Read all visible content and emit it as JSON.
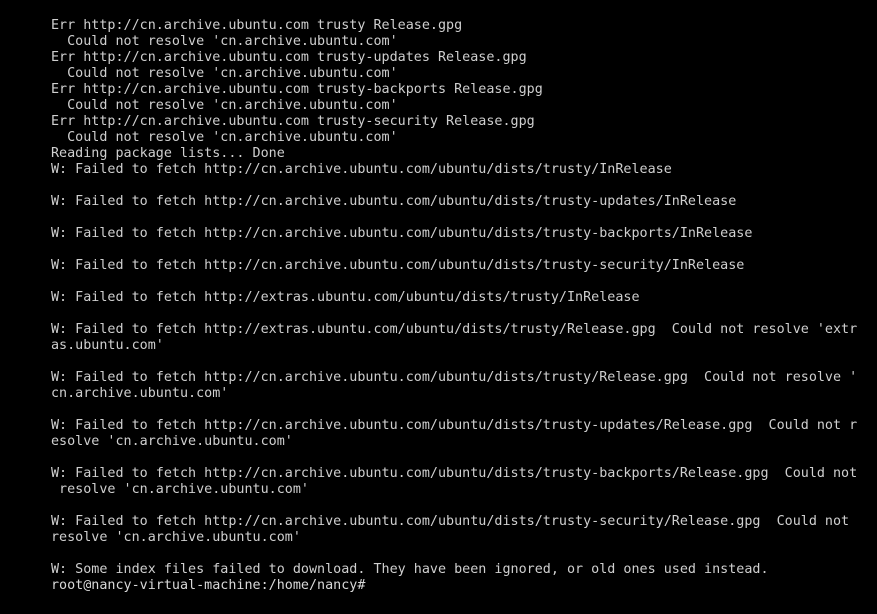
{
  "terminal": {
    "lines": [
      "Err http://cn.archive.ubuntu.com trusty Release.gpg",
      "  Could not resolve 'cn.archive.ubuntu.com'",
      "Err http://cn.archive.ubuntu.com trusty-updates Release.gpg",
      "  Could not resolve 'cn.archive.ubuntu.com'",
      "Err http://cn.archive.ubuntu.com trusty-backports Release.gpg",
      "  Could not resolve 'cn.archive.ubuntu.com'",
      "Err http://cn.archive.ubuntu.com trusty-security Release.gpg",
      "  Could not resolve 'cn.archive.ubuntu.com'",
      "Reading package lists... Done",
      "W: Failed to fetch http://cn.archive.ubuntu.com/ubuntu/dists/trusty/InRelease",
      "",
      "W: Failed to fetch http://cn.archive.ubuntu.com/ubuntu/dists/trusty-updates/InRelease",
      "",
      "W: Failed to fetch http://cn.archive.ubuntu.com/ubuntu/dists/trusty-backports/InRelease",
      "",
      "W: Failed to fetch http://cn.archive.ubuntu.com/ubuntu/dists/trusty-security/InRelease",
      "",
      "W: Failed to fetch http://extras.ubuntu.com/ubuntu/dists/trusty/InRelease",
      "",
      "W: Failed to fetch http://extras.ubuntu.com/ubuntu/dists/trusty/Release.gpg  Could not resolve 'extr",
      "as.ubuntu.com'",
      "",
      "W: Failed to fetch http://cn.archive.ubuntu.com/ubuntu/dists/trusty/Release.gpg  Could not resolve '",
      "cn.archive.ubuntu.com'",
      "",
      "W: Failed to fetch http://cn.archive.ubuntu.com/ubuntu/dists/trusty-updates/Release.gpg  Could not r",
      "esolve 'cn.archive.ubuntu.com'",
      "",
      "W: Failed to fetch http://cn.archive.ubuntu.com/ubuntu/dists/trusty-backports/Release.gpg  Could not",
      " resolve 'cn.archive.ubuntu.com'",
      "",
      "W: Failed to fetch http://cn.archive.ubuntu.com/ubuntu/dists/trusty-security/Release.gpg  Could not",
      "resolve 'cn.archive.ubuntu.com'",
      "",
      "W: Some index files failed to download. They have been ignored, or old ones used instead."
    ],
    "prompt": "root@nancy-virtual-machine:/home/nancy#"
  }
}
